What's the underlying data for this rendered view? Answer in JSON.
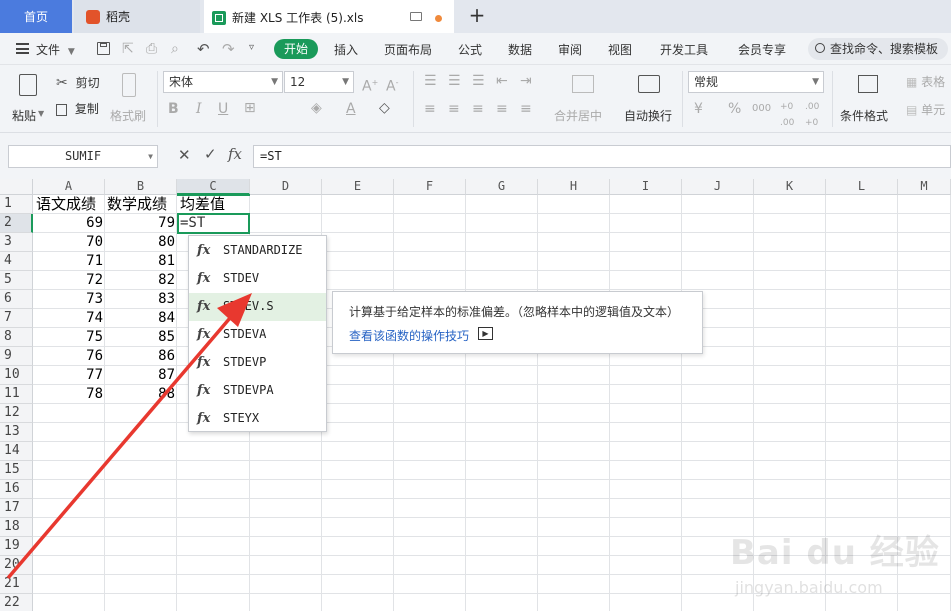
{
  "tabs": {
    "home": "首页",
    "docer": "稻壳",
    "file": "新建 XLS 工作表 (5).xls",
    "new_tab": "+"
  },
  "menu": {
    "file": "文件",
    "items": [
      "开始",
      "插入",
      "页面布局",
      "公式",
      "数据",
      "审阅",
      "视图",
      "开发工具",
      "会员专享"
    ],
    "search": "查找命令、搜索模板"
  },
  "ribbon": {
    "paste": "粘贴",
    "cut": "剪切",
    "copy": "复制",
    "format_painter": "格式刷",
    "font_name": "宋体",
    "font_size": "12",
    "merge_center": "合并居中",
    "wrap_text": "自动换行",
    "number_format": "常规",
    "conditional_format": "条件格式",
    "table_style": "表格",
    "cell": "单元"
  },
  "formula_bar": {
    "name_box": "SUMIF",
    "fx": "fx",
    "formula": "=ST"
  },
  "sheet": {
    "columns": [
      "A",
      "B",
      "C",
      "D",
      "E",
      "F",
      "G",
      "H",
      "I",
      "J",
      "K",
      "L",
      "M"
    ],
    "rows": [
      "1",
      "2",
      "3",
      "4",
      "5",
      "6",
      "7",
      "8",
      "9",
      "10",
      "11",
      "12",
      "13",
      "14",
      "15",
      "16",
      "17",
      "18",
      "19",
      "20",
      "21",
      "22"
    ],
    "headers": {
      "A": "语文成绩",
      "B": "数学成绩",
      "C": "均差值"
    },
    "colA": [
      "69",
      "70",
      "71",
      "72",
      "73",
      "74",
      "75",
      "76",
      "77",
      "78"
    ],
    "colB": [
      "79",
      "80",
      "81",
      "82",
      "83",
      "84",
      "85",
      "86",
      "87",
      "88"
    ],
    "active_cell": "=ST"
  },
  "autocomplete": {
    "fx": "fx",
    "items": [
      "STANDARDIZE",
      "STDEV",
      "STDEV.S",
      "STDEVA",
      "STDEVP",
      "STDEVPA",
      "STEYX"
    ],
    "selected": "STDEV.S",
    "description": "计算基于给定样本的标准偏差。（忽略样本中的逻辑值及文本）",
    "link": "查看该函数的操作技巧"
  },
  "watermark": {
    "brand": "Bai du 经验",
    "url": "jingyan.baidu.com"
  },
  "colors": {
    "accent_green": "#1a9a5a",
    "home_tab_blue": "#4b7bde",
    "annotation_red": "#e8382f",
    "link_blue": "#2763c4"
  }
}
